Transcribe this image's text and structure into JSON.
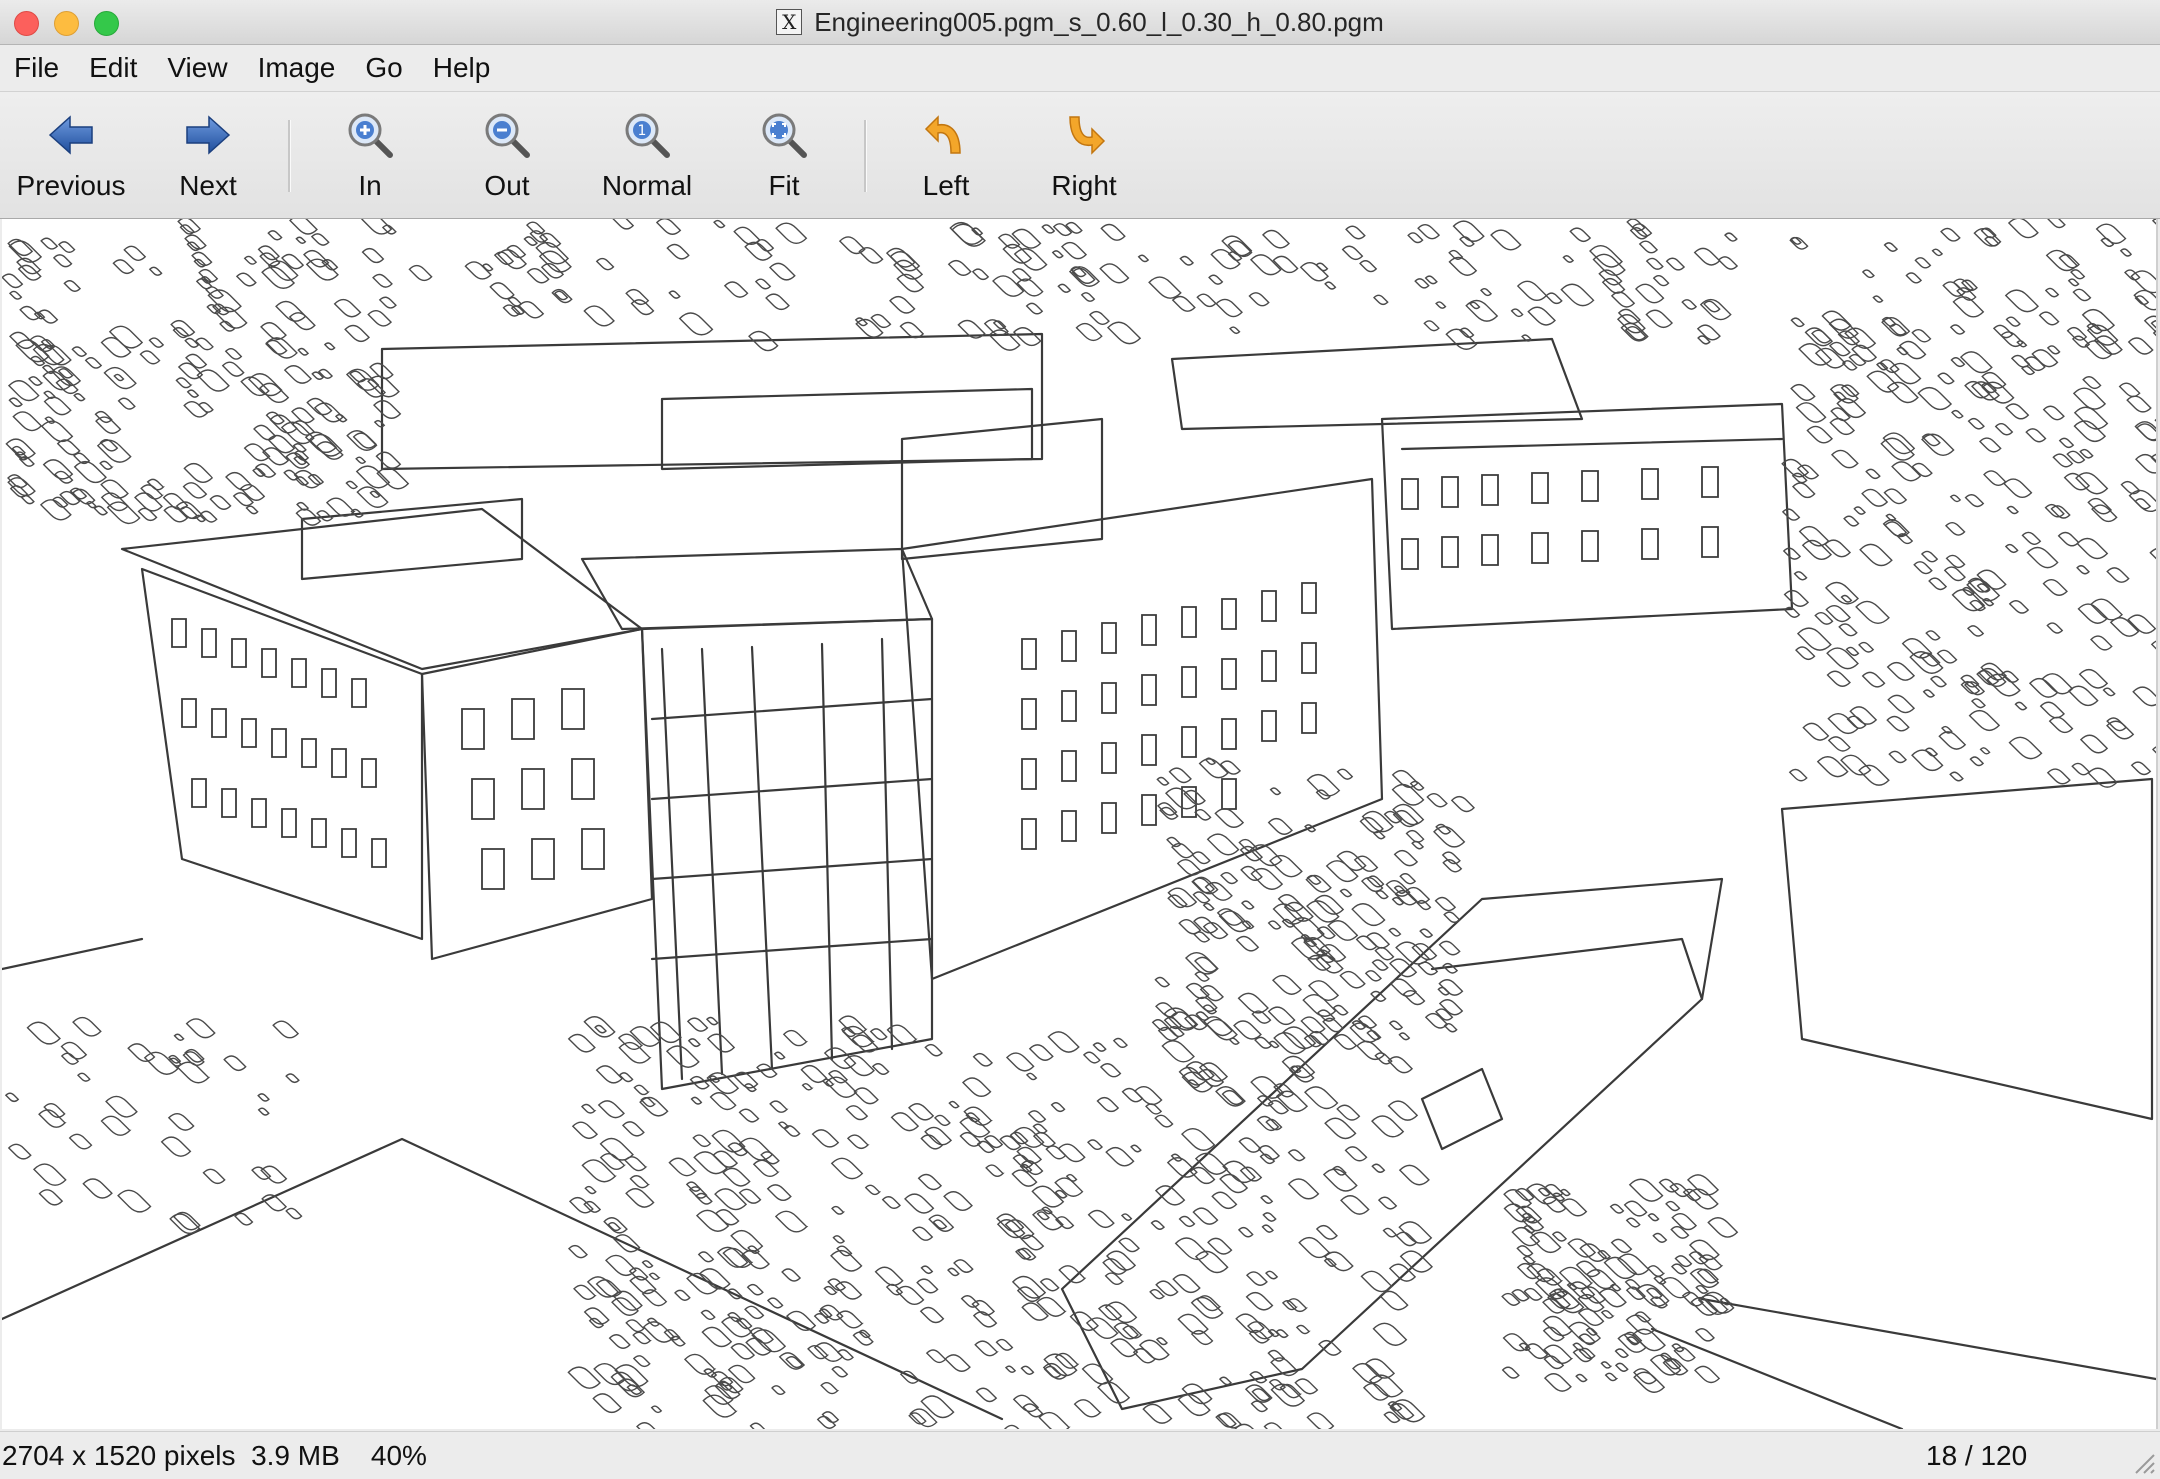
{
  "window": {
    "title": "Engineering005.pgm_s_0.60_l_0.30_h_0.80.pgm",
    "app_icon_glyph": "X",
    "controls": {
      "close_color": "#fc605c",
      "minimize_color": "#fdbc40",
      "zoom_color": "#34c84a"
    }
  },
  "menu": {
    "items": [
      {
        "label": "File"
      },
      {
        "label": "Edit"
      },
      {
        "label": "View"
      },
      {
        "label": "Image"
      },
      {
        "label": "Go"
      },
      {
        "label": "Help"
      }
    ]
  },
  "toolbar": {
    "previous": {
      "label": "Previous",
      "icon": "arrow-left-icon"
    },
    "next": {
      "label": "Next",
      "icon": "arrow-right-icon"
    },
    "zoom_in": {
      "label": "In",
      "icon": "zoom-in-icon"
    },
    "zoom_out": {
      "label": "Out",
      "icon": "zoom-out-icon"
    },
    "zoom_normal": {
      "label": "Normal",
      "icon": "zoom-normal-icon",
      "glyph": "1"
    },
    "zoom_fit": {
      "label": "Fit",
      "icon": "zoom-fit-icon"
    },
    "rotate_left": {
      "label": "Left",
      "icon": "rotate-left-icon"
    },
    "rotate_right": {
      "label": "Right",
      "icon": "rotate-right-icon"
    },
    "colors": {
      "arrow_blue": "#2f65b8",
      "rotate_orange": "#f0a020"
    }
  },
  "image": {
    "description_type": "edge-detected grayscale aerial photo of buildings",
    "background": "#ffffff",
    "stroke": "#3a3a3a"
  },
  "status": {
    "dimensions": "2704 x 1520 pixels",
    "size": "3.9 MB",
    "zoom": "40%",
    "position": "18 / 120"
  }
}
